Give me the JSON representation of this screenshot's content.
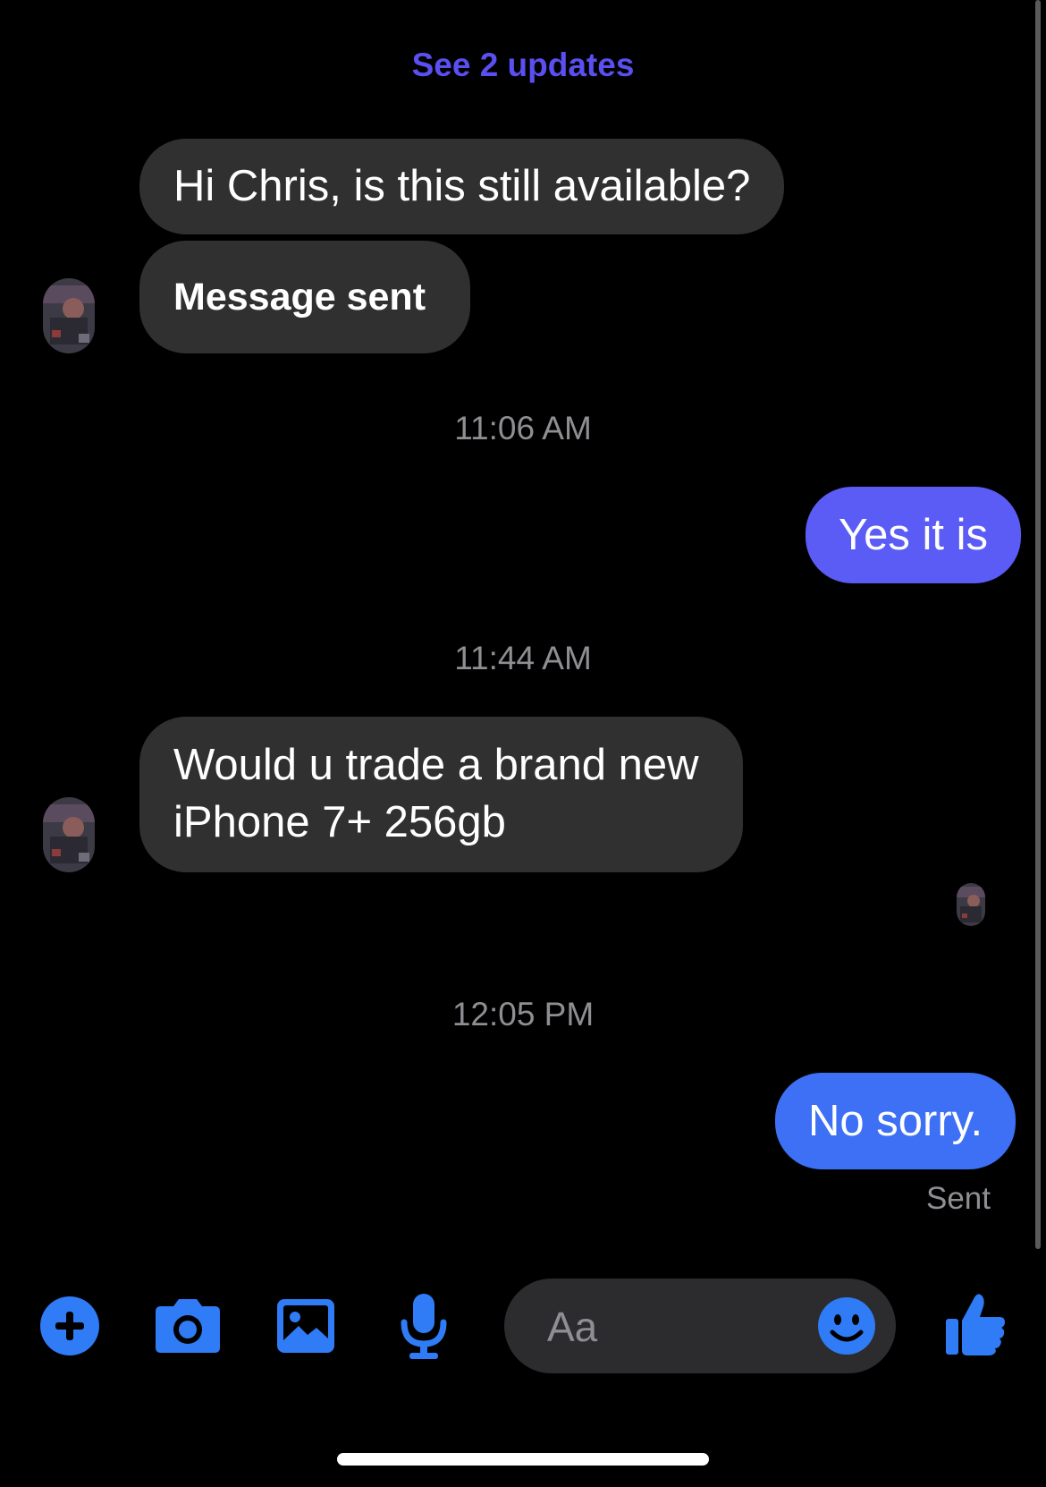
{
  "header": {
    "updates_link": "See 2 updates"
  },
  "colors": {
    "accent": "#5a4ff0",
    "outgoing_bubble_1": "#5b5cf6",
    "outgoing_bubble_2": "#3d70f4",
    "incoming_bubble": "#303030",
    "icon_blue": "#2f7cf6",
    "meta_gray": "#8e8e93"
  },
  "messages": [
    {
      "direction": "incoming",
      "text": "Hi Chris, is this still available?"
    },
    {
      "direction": "incoming",
      "text": "Message sent"
    },
    {
      "type": "timestamp",
      "text": "11:06 AM"
    },
    {
      "direction": "outgoing",
      "text": "Yes it is"
    },
    {
      "type": "timestamp",
      "text": "11:44 AM"
    },
    {
      "direction": "incoming",
      "lines": [
        "Would u trade a brand new",
        "iPhone 7+ 256gb"
      ]
    },
    {
      "type": "timestamp",
      "text": "12:05 PM"
    },
    {
      "direction": "outgoing",
      "text": "No sorry."
    }
  ],
  "status": "Sent",
  "composer": {
    "placeholder": "Aa",
    "icons": [
      "plus-icon",
      "camera-icon",
      "photo-gallery-icon",
      "microphone-icon",
      "emoji-icon",
      "thumbs-up-icon"
    ]
  }
}
